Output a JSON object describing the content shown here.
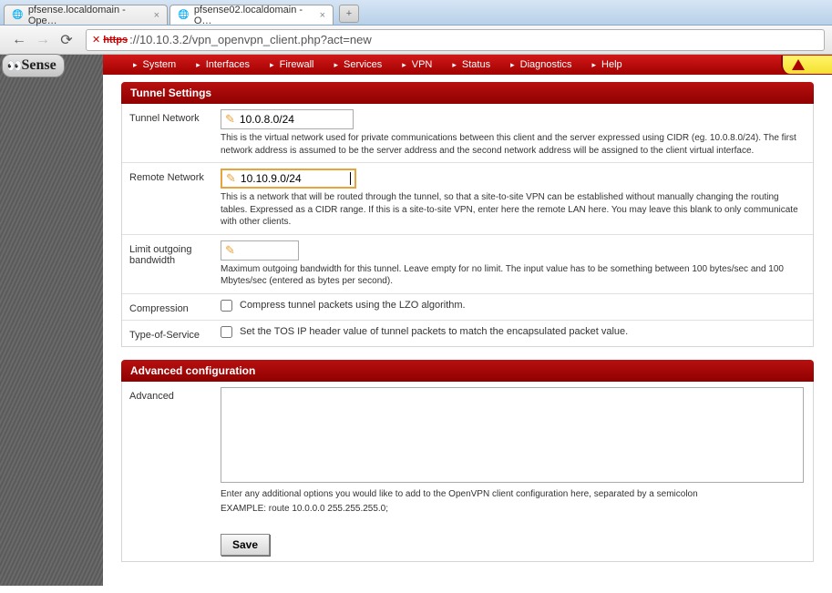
{
  "browser": {
    "tabs": [
      {
        "title": "pfsense.localdomain - Ope…",
        "active": false
      },
      {
        "title": "pfsense02.localdomain - O…",
        "active": true
      }
    ],
    "url_proto": "https",
    "url_rest": "://10.10.3.2/vpn_openvpn_client.php?act=new"
  },
  "logo": {
    "text": "Sense"
  },
  "nav": {
    "items": [
      "System",
      "Interfaces",
      "Firewall",
      "Services",
      "VPN",
      "Status",
      "Diagnostics",
      "Help"
    ]
  },
  "sections": {
    "tunnel": {
      "title": "Tunnel Settings",
      "rows": {
        "tunnel_network": {
          "label": "Tunnel Network",
          "value": "10.0.8.0/24",
          "help": "This is the virtual network used for private communications between this client and the server expressed using CIDR (eg. 10.0.8.0/24). The first network address is assumed to be the server address and the second network address will be assigned to the client virtual interface."
        },
        "remote_network": {
          "label": "Remote Network",
          "value": "10.10.9.0/24",
          "help": "This is a network that will be routed through the tunnel, so that a site-to-site VPN can be established without manually changing the routing tables. Expressed as a CIDR range. If this is a site-to-site VPN, enter here the remote LAN here. You may leave this blank to only communicate with other clients."
        },
        "limit_bw": {
          "label": "Limit outgoing bandwidth",
          "value": "",
          "help": "Maximum outgoing bandwidth for this tunnel. Leave empty for no limit. The input value has to be something between 100 bytes/sec and 100 Mbytes/sec (entered as bytes per second)."
        },
        "compression": {
          "label": "Compression",
          "cblabel": "Compress tunnel packets using the LZO algorithm."
        },
        "tos": {
          "label": "Type-of-Service",
          "cblabel": "Set the TOS IP header value of tunnel packets to match the encapsulated packet value."
        }
      }
    },
    "advanced": {
      "title": "Advanced configuration",
      "label": "Advanced",
      "value": "",
      "help1": "Enter any additional options you would like to add to the OpenVPN client configuration here, separated by a semicolon",
      "help2": "EXAMPLE: route 10.0.0.0 255.255.255.0;"
    }
  },
  "buttons": {
    "save": "Save"
  }
}
